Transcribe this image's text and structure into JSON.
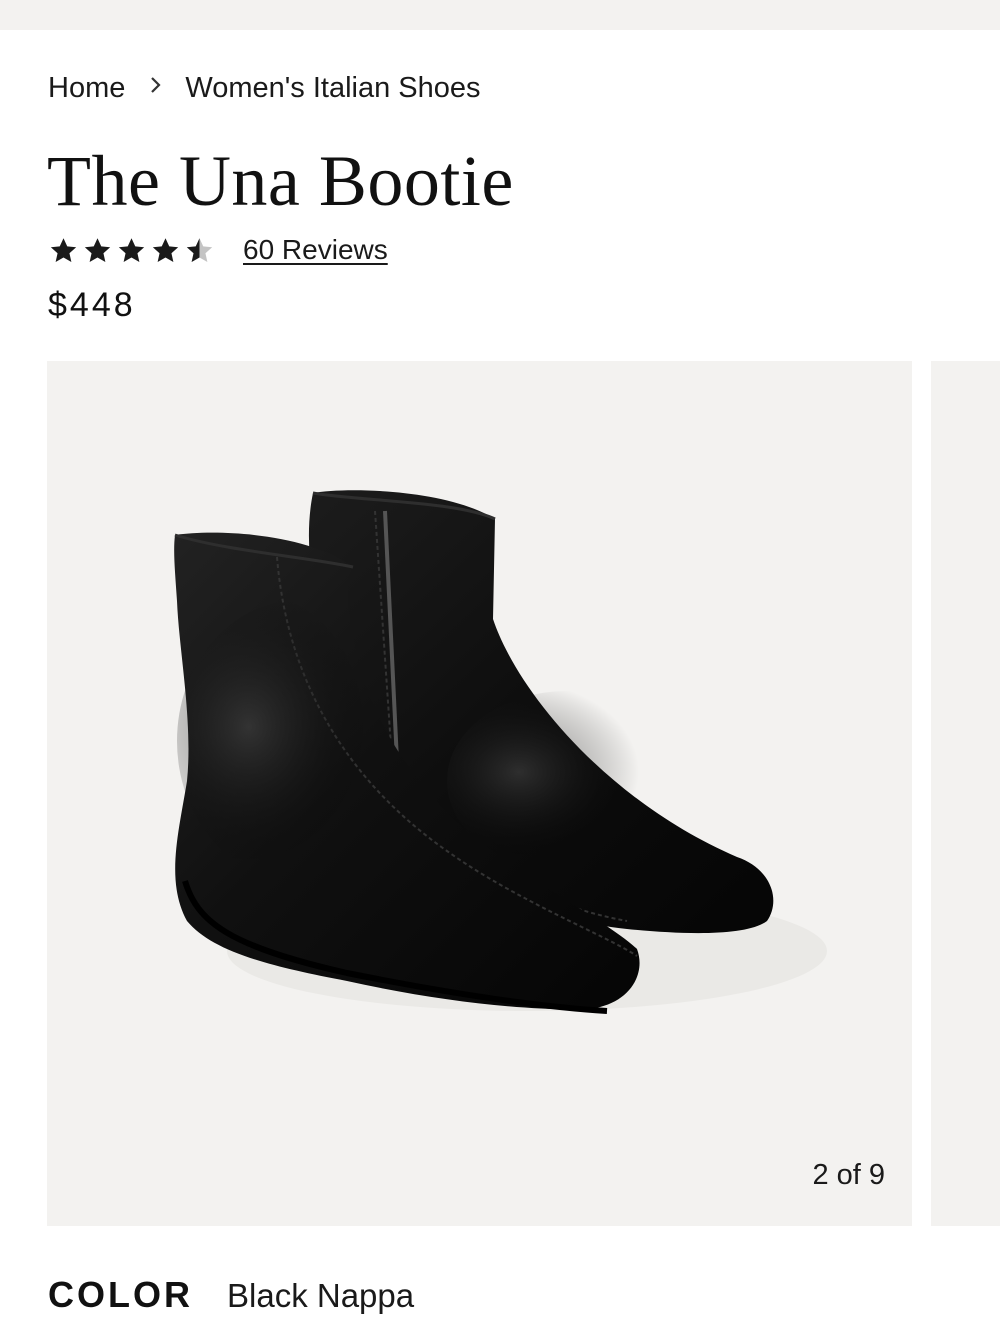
{
  "breadcrumb": {
    "home": "Home",
    "category": "Women's Italian Shoes",
    "separator_icon": "chevron-right-icon"
  },
  "product": {
    "title": "The Una Bootie",
    "rating": 4.5,
    "rating_max": 5,
    "reviews_label": "60 Reviews",
    "price": "$448"
  },
  "gallery": {
    "counter": "2 of 9",
    "image_alt": "Black leather ankle booties"
  },
  "color": {
    "label": "COLOR",
    "value": "Black Nappa"
  },
  "colors": {
    "background": "#ffffff",
    "panel": "#f3f2f0",
    "text": "#1a1a1a",
    "star": "#1a1a1a",
    "star_empty": "#c4c4c4"
  }
}
